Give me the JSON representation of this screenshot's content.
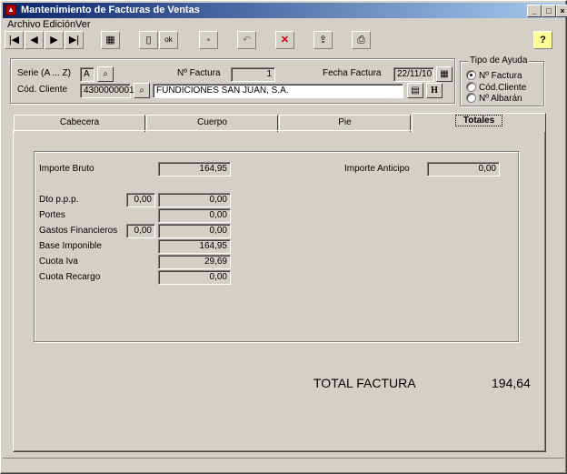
{
  "window": {
    "title": "Mantenimiento de Facturas de Ventas"
  },
  "titlebar_buttons": {
    "minimize": "_",
    "maximize": "□",
    "close": "×"
  },
  "menu": [
    "Archivo",
    "Edición",
    "Ver"
  ],
  "toolbar": {
    "first": "|◀",
    "prev": "◀",
    "next": "▶",
    "last": "▶|",
    "table": "▦",
    "new": "▯",
    "ok": "ok",
    "save": "▪",
    "undo": "↶",
    "delete": "✕",
    "export": "⇪",
    "print": "⎙",
    "help": "?"
  },
  "header": {
    "serie_label": "Serie (A ... Z)",
    "serie_value": "A",
    "num_factura_label": "Nº Factura",
    "num_factura_value": "1",
    "fecha_label": "Fecha Factura",
    "fecha_value": "22/11/10",
    "cliente_label": "Cód. Cliente",
    "cliente_code": "4300000001",
    "cliente_name": "FUNDICIONES SAN JUAN, S.A.",
    "h_button": "H"
  },
  "ayuda": {
    "title": "Tipo de Ayuda",
    "options": [
      "Nº Factura",
      "Cód.Cliente",
      "Nº Albarán"
    ],
    "selected": 0
  },
  "tabs": [
    "Cabecera",
    "Cuerpo",
    "Pie",
    "Totales"
  ],
  "active_tab": 3,
  "totales": {
    "importe_bruto_label": "Importe Bruto",
    "importe_bruto": "164,95",
    "importe_anticipo_label": "Importe Anticipo",
    "importe_anticipo": "0,00",
    "dto_label": "Dto p.p.p.",
    "dto_pct": "0,00",
    "dto_value": "0,00",
    "portes_label": "Portes",
    "portes_value": "0,00",
    "gastos_label": "Gastos Financieros",
    "gastos_pct": "0,00",
    "gastos_value": "0,00",
    "base_label": "Base Imponible",
    "base_value": "164,95",
    "iva_label": "Cuota Iva",
    "iva_value": "29,69",
    "recargo_label": "Cuota Recargo",
    "recargo_value": "0,00",
    "total_label": "TOTAL FACTURA",
    "total_value": "194,64"
  }
}
